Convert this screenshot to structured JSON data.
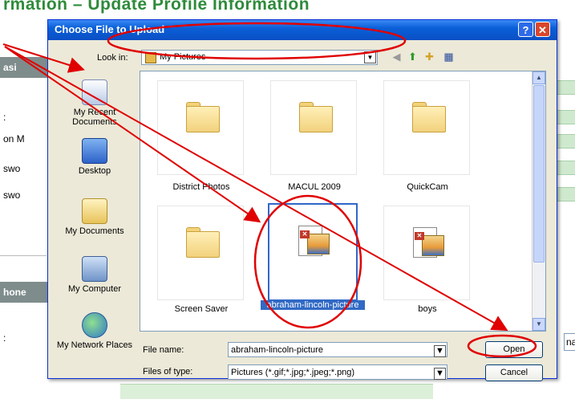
{
  "background_page": {
    "title_fragment": "rmation – Update Profile Information",
    "bar1_fragment": "asi",
    "bar2_fragment": "hone",
    "labels": [
      ":",
      "on M",
      "swo",
      "swo"
    ],
    "bottom_label": ":",
    "right_input_fragment": "na"
  },
  "dialog": {
    "title": "Choose File to Upload",
    "help_label": "?",
    "close_label": "✕",
    "look_in_label": "Look in:",
    "look_in_value": "My Pictures",
    "places": [
      {
        "label": "My Recent Documents",
        "icon": "recent-documents-icon"
      },
      {
        "label": "Desktop",
        "icon": "desktop-icon"
      },
      {
        "label": "My Documents",
        "icon": "my-documents-icon"
      },
      {
        "label": "My Computer",
        "icon": "my-computer-icon"
      },
      {
        "label": "My Network Places",
        "icon": "network-places-icon"
      }
    ],
    "files": [
      {
        "name": "District Photos",
        "type": "folder"
      },
      {
        "name": "MACUL 2009",
        "type": "folder"
      },
      {
        "name": "QuickCam",
        "type": "folder"
      },
      {
        "name": "Screen Saver",
        "type": "folder"
      },
      {
        "name": "abraham-lincoln-picture",
        "type": "image",
        "selected": true
      },
      {
        "name": "boys",
        "type": "image"
      }
    ],
    "file_name_label": "File name:",
    "file_name_value": "abraham-lincoln-picture",
    "file_type_label": "Files of type:",
    "file_type_value": "Pictures (*.gif;*.jpg;*.jpeg;*.png)",
    "open_label": "Open",
    "cancel_label": "Cancel"
  },
  "colors": {
    "annotation": "#e00000",
    "title_bar": "#0a5fd8",
    "selection": "#316ac5"
  }
}
